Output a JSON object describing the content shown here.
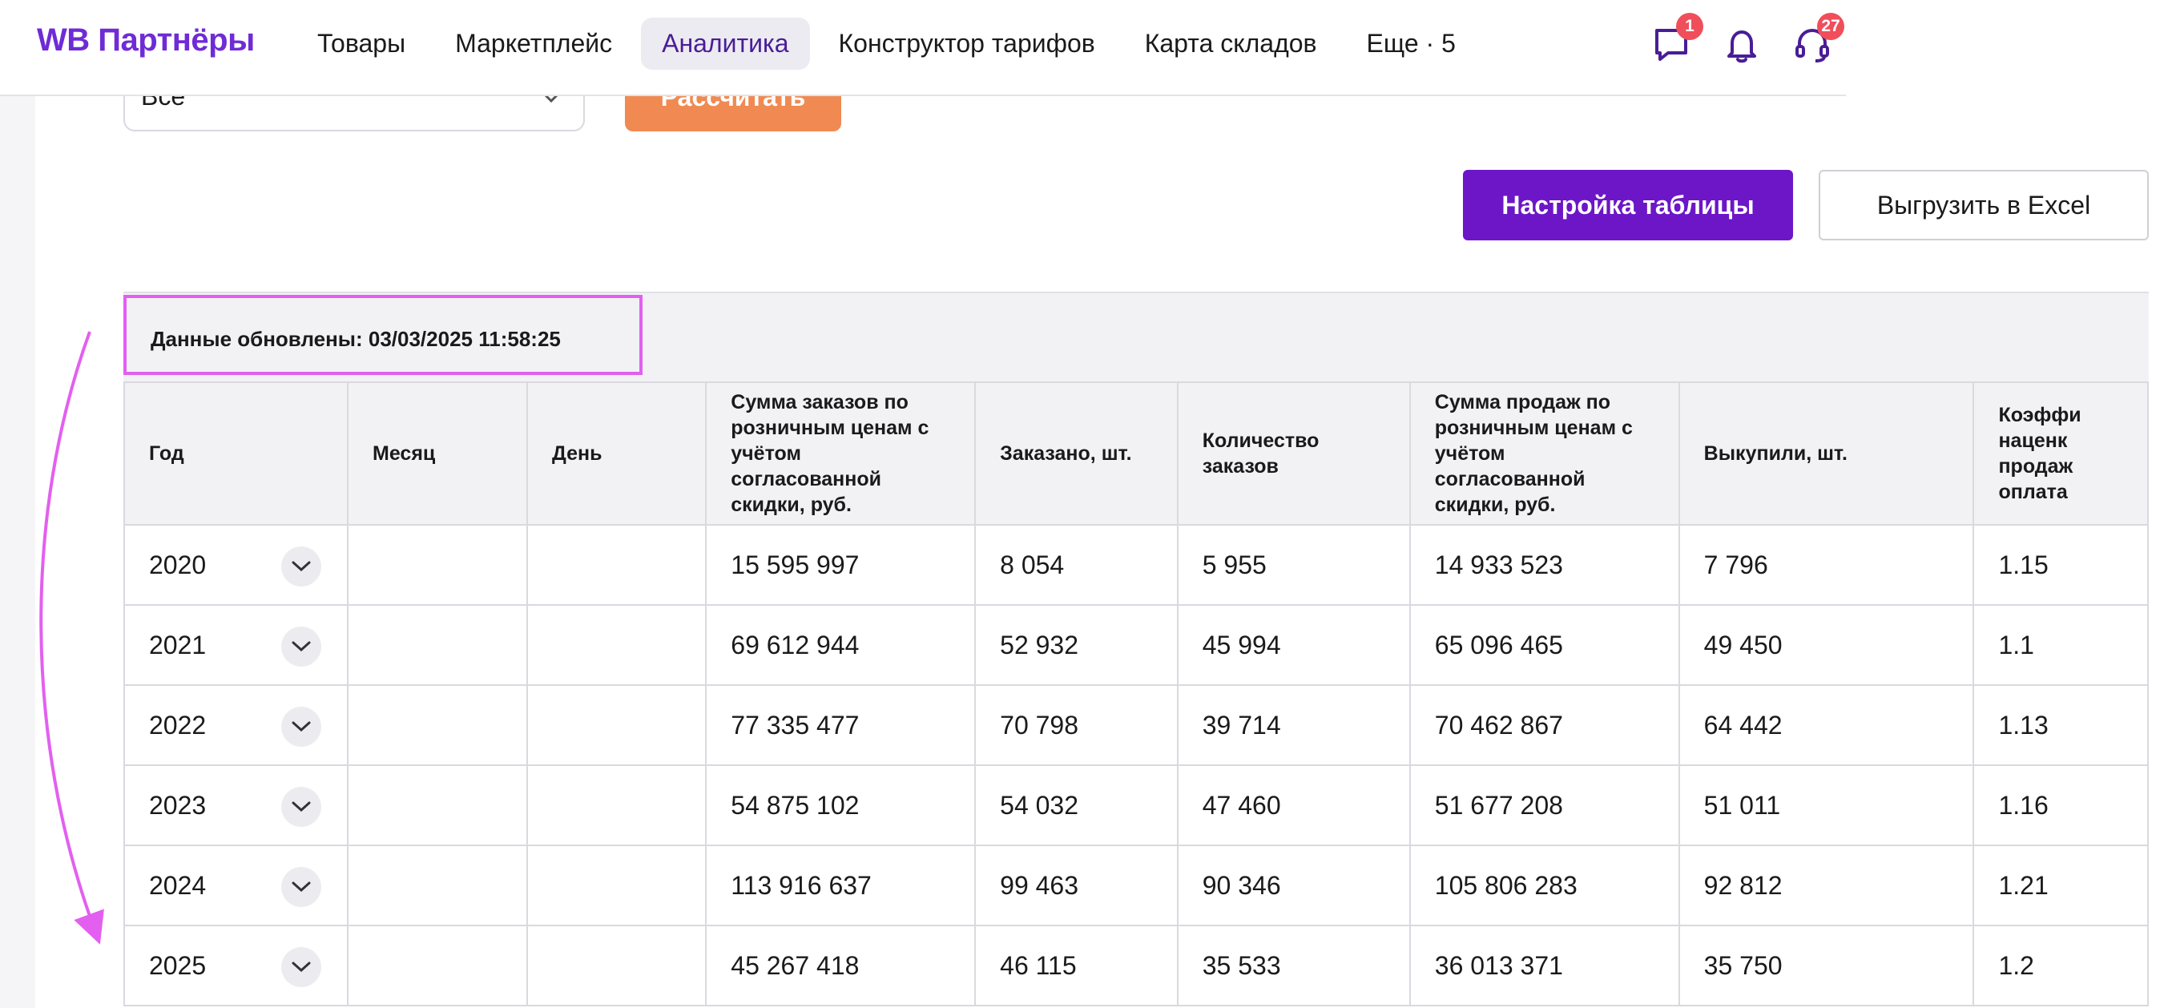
{
  "header": {
    "logo": "WB Партнёры",
    "nav": [
      {
        "label": "Товары",
        "active": false
      },
      {
        "label": "Маркетплейс",
        "active": false
      },
      {
        "label": "Аналитика",
        "active": true
      },
      {
        "label": "Конструктор тарифов",
        "active": false
      },
      {
        "label": "Карта складов",
        "active": false
      },
      {
        "label": "Еще · 5",
        "active": false
      }
    ],
    "chat_badge": "1",
    "support_badge": "27"
  },
  "filters": {
    "select_value": "Все",
    "calculate_label": "Рассчитать"
  },
  "actions": {
    "settings_label": "Настройка таблицы",
    "excel_label": "Выгрузить в Excel"
  },
  "updated_text": "Данные обновлены: 03/03/2025 11:58:25",
  "table": {
    "headers": [
      "Год",
      "Месяц",
      "День",
      "Сумма заказов по розничным ценам с учётом согласованной скидки, руб.",
      "Заказано, шт.",
      "Количество заказов",
      "Сумма продаж по розничным ценам с учётом согласованной скидки, руб.",
      "Выкупили, шт.",
      "Коэффи наценк продаж оплата"
    ],
    "rows": [
      {
        "year": "2020",
        "month": "",
        "day": "",
        "orders_sum": "15 595 997",
        "ordered": "8 054",
        "orders_count": "5 955",
        "sales_sum": "14 933 523",
        "bought": "7 796",
        "coef": "1.15"
      },
      {
        "year": "2021",
        "month": "",
        "day": "",
        "orders_sum": "69 612 944",
        "ordered": "52 932",
        "orders_count": "45 994",
        "sales_sum": "65 096 465",
        "bought": "49 450",
        "coef": "1.1"
      },
      {
        "year": "2022",
        "month": "",
        "day": "",
        "orders_sum": "77 335 477",
        "ordered": "70 798",
        "orders_count": "39 714",
        "sales_sum": "70 462 867",
        "bought": "64 442",
        "coef": "1.13"
      },
      {
        "year": "2023",
        "month": "",
        "day": "",
        "orders_sum": "54 875 102",
        "ordered": "54 032",
        "orders_count": "47 460",
        "sales_sum": "51 677 208",
        "bought": "51 011",
        "coef": "1.16"
      },
      {
        "year": "2024",
        "month": "",
        "day": "",
        "orders_sum": "113 916 637",
        "ordered": "99 463",
        "orders_count": "90 346",
        "sales_sum": "105 806 283",
        "bought": "92 812",
        "coef": "1.21"
      },
      {
        "year": "2025",
        "month": "",
        "day": "",
        "orders_sum": "45 267 418",
        "ordered": "46 115",
        "orders_count": "35 533",
        "sales_sum": "36 013 371",
        "bought": "35 750",
        "coef": "1.2"
      }
    ]
  },
  "colors": {
    "brand": "#6f2bd6",
    "primary_button": "#6c16c7",
    "calculate_button": "#f08a52",
    "annotation": "#e35ff0",
    "badge": "#f04e5b"
  }
}
